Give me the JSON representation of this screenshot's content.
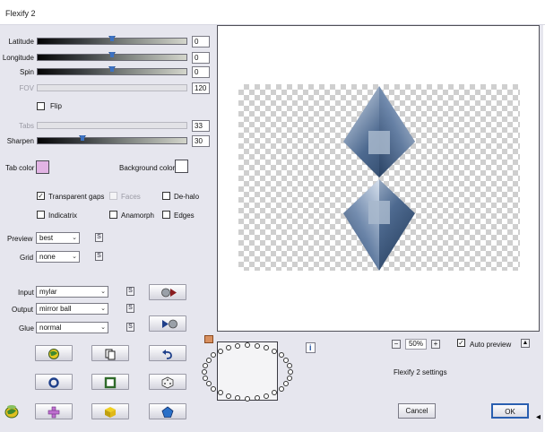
{
  "window": {
    "title": "Flexify 2"
  },
  "sliders": {
    "latitude": {
      "label": "Latitude",
      "value": "0",
      "level": 0.5
    },
    "longitude": {
      "label": "Longitude",
      "value": "0",
      "level": 0.5
    },
    "spin": {
      "label": "Spin",
      "value": "0",
      "level": 0.5
    },
    "fov": {
      "label": "FOV",
      "value": "120",
      "level": 0.0
    },
    "tabs": {
      "label": "Tabs",
      "value": "33",
      "level": 0.0
    },
    "sharpen": {
      "label": "Sharpen",
      "value": "30",
      "level": 0.3
    }
  },
  "flip": {
    "label": "Flip",
    "checked": false
  },
  "colors": {
    "tab_color_label": "Tab color",
    "tab_color": "#e2b4e4",
    "background_color_label": "Background color",
    "background_color": "#ffffff"
  },
  "options": {
    "transparent_gaps": {
      "label": "Transparent gaps",
      "checked": true
    },
    "faces": {
      "label": "Faces",
      "checked": false
    },
    "de_halo": {
      "label": "De-halo",
      "checked": false
    },
    "indicatrix": {
      "label": "Indicatrix",
      "checked": false
    },
    "anamorph": {
      "label": "Anamorph",
      "checked": false
    },
    "edges": {
      "label": "Edges",
      "checked": false
    }
  },
  "dropdowns": {
    "preview": {
      "label": "Preview",
      "value": "best"
    },
    "grid": {
      "label": "Grid",
      "value": "none"
    },
    "input": {
      "label": "Input",
      "value": "mylar"
    },
    "output": {
      "label": "Output",
      "value": "mirror ball"
    },
    "glue": {
      "label": "Glue",
      "value": "normal"
    }
  },
  "small_button_glyph": "S",
  "zoom": {
    "value": "50%",
    "minus": "−",
    "plus": "+"
  },
  "auto_preview": {
    "label": "Auto preview",
    "checked": true
  },
  "settings_label": "Flexify 2 settings",
  "info_glyph": "i",
  "buttons": {
    "cancel": "Cancel",
    "ok": "OK"
  },
  "accent": {
    "ok_border": "#2a5fb0",
    "thumb": "#2c5aa0"
  }
}
